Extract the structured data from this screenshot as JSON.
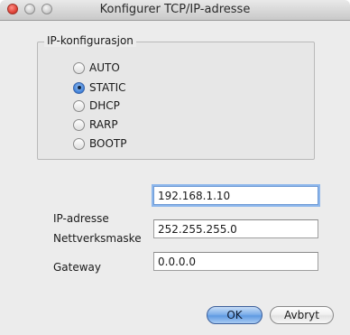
{
  "window": {
    "title": "Konfigurer TCP/IP-adresse"
  },
  "ip_config": {
    "group_label": "IP-konfigurasjon",
    "options": [
      {
        "label": "AUTO",
        "selected": false
      },
      {
        "label": "STATIC",
        "selected": true
      },
      {
        "label": "DHCP",
        "selected": false
      },
      {
        "label": "RARP",
        "selected": false
      },
      {
        "label": "BOOTP",
        "selected": false
      }
    ]
  },
  "fields": {
    "ip_label": "IP-adresse",
    "ip_value": "192.168.1.10",
    "mask_label": "Nettverksmaske",
    "mask_value": "252.255.255.0",
    "gateway_label": "Gateway",
    "gateway_value": "0.0.0.0"
  },
  "buttons": {
    "ok_label": "OK",
    "cancel_label": "Avbryt"
  },
  "colors": {
    "accent": "#5f9ae2",
    "window_bg": "#ececec"
  }
}
